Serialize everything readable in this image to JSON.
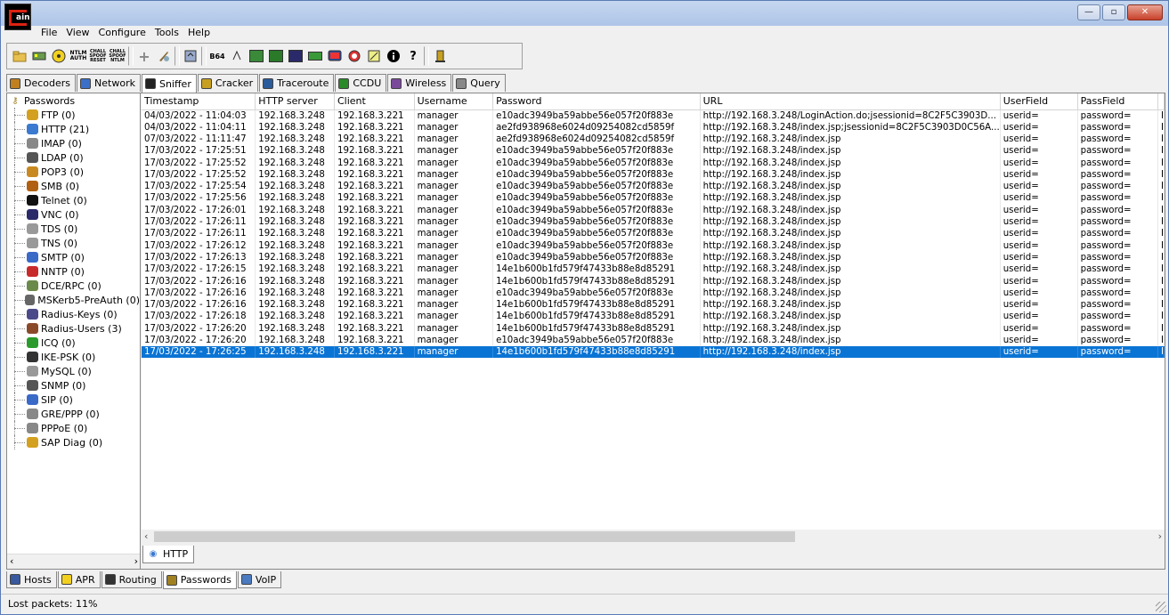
{
  "app": {
    "logo_text": "ain"
  },
  "menu": [
    "File",
    "View",
    "Configure",
    "Tools",
    "Help"
  ],
  "window_controls": {
    "minimize": "—",
    "maximize": "▫",
    "close": "✕"
  },
  "toolbar": {
    "icons": [
      "open-folder-icon",
      "network-card-icon",
      "radiation-icon",
      "ntlm-auth-icon",
      "chall-spoof-reset-icon",
      "chall-spoof-ntlm-icon",
      "add-icon",
      "broom-icon",
      "recycle-icon",
      "base64-icon",
      "terminal-icon",
      "lsa-icon",
      "lsa2-icon",
      "vnc-icon",
      "mem-icon",
      "monitor-icon",
      "globe-icon",
      "edit-icon",
      "info-icon",
      "help-icon",
      "exit-icon"
    ],
    "ntlm_label": "NTLM\nAUTH",
    "chall1_label": "CHALL\nSPOOF\nRESET",
    "chall2_label": "CHALL\nSPOOF\nNTLM",
    "b64_label": "B64"
  },
  "tabs": [
    {
      "label": "Decoders",
      "icon": "decoder-icon",
      "color": "#c08020",
      "active": false
    },
    {
      "label": "Network",
      "icon": "network-icon",
      "color": "#3b6fc8",
      "active": false
    },
    {
      "label": "Sniffer",
      "icon": "sniffer-icon",
      "color": "#222222",
      "active": true
    },
    {
      "label": "Cracker",
      "icon": "cracker-icon",
      "color": "#c8a020",
      "active": false
    },
    {
      "label": "Traceroute",
      "icon": "traceroute-icon",
      "color": "#2a5a9a",
      "active": false
    },
    {
      "label": "CCDU",
      "icon": "ccdu-icon",
      "color": "#2a8a2a",
      "active": false
    },
    {
      "label": "Wireless",
      "icon": "wireless-icon",
      "color": "#7a4a9a",
      "active": false
    },
    {
      "label": "Query",
      "icon": "query-icon",
      "color": "#888888",
      "active": false
    }
  ],
  "tree": {
    "root": "Passwords",
    "items": [
      {
        "label": "FTP (0)",
        "icon": "ftp-icon",
        "color": "#d4a020"
      },
      {
        "label": "HTTP (21)",
        "icon": "http-icon",
        "color": "#3a7ad0"
      },
      {
        "label": "IMAP (0)",
        "icon": "imap-icon",
        "color": "#888888"
      },
      {
        "label": "LDAP (0)",
        "icon": "ldap-icon",
        "color": "#555555"
      },
      {
        "label": "POP3 (0)",
        "icon": "pop3-icon",
        "color": "#c88a20"
      },
      {
        "label": "SMB (0)",
        "icon": "smb-icon",
        "color": "#b06010"
      },
      {
        "label": "Telnet (0)",
        "icon": "telnet-icon",
        "color": "#111111"
      },
      {
        "label": "VNC (0)",
        "icon": "vnc-icon",
        "color": "#2a2a6a"
      },
      {
        "label": "TDS (0)",
        "icon": "tds-icon",
        "color": "#999999"
      },
      {
        "label": "TNS (0)",
        "icon": "tns-icon",
        "color": "#999999"
      },
      {
        "label": "SMTP (0)",
        "icon": "smtp-icon",
        "color": "#3a6ac8"
      },
      {
        "label": "NNTP (0)",
        "icon": "nntp-icon",
        "color": "#c82a2a"
      },
      {
        "label": "DCE/RPC (0)",
        "icon": "dcerpc-icon",
        "color": "#6a8a4a"
      },
      {
        "label": "MSKerb5-PreAuth (0)",
        "icon": "mskerb5-icon",
        "color": "#666666"
      },
      {
        "label": "Radius-Keys (0)",
        "icon": "radius-keys-icon",
        "color": "#4a4a8a"
      },
      {
        "label": "Radius-Users (3)",
        "icon": "radius-users-icon",
        "color": "#8a4a2a"
      },
      {
        "label": "ICQ (0)",
        "icon": "icq-icon",
        "color": "#2a9a2a"
      },
      {
        "label": "IKE-PSK (0)",
        "icon": "ike-psk-icon",
        "color": "#333333"
      },
      {
        "label": "MySQL (0)",
        "icon": "mysql-icon",
        "color": "#999999"
      },
      {
        "label": "SNMP (0)",
        "icon": "snmp-icon",
        "color": "#555555"
      },
      {
        "label": "SIP (0)",
        "icon": "sip-icon",
        "color": "#3a6ac8"
      },
      {
        "label": "GRE/PPP (0)",
        "icon": "gre-ppp-icon",
        "color": "#888888"
      },
      {
        "label": "PPPoE (0)",
        "icon": "pppoe-icon",
        "color": "#888888"
      },
      {
        "label": "SAP Diag (0)",
        "icon": "sap-diag-icon",
        "color": "#d4a020"
      }
    ]
  },
  "grid": {
    "columns": [
      "Timestamp",
      "HTTP server",
      "Client",
      "Username",
      "Password",
      "URL",
      "UserField",
      "PassField",
      ""
    ],
    "rows": [
      [
        "04/03/2022 - 11:04:03",
        "192.168.3.248",
        "192.168.3.221",
        "manager",
        "e10adc3949ba59abbe56e057f20f883e",
        "http://192.168.3.248/LoginAction.do;jsessionid=8C2F5C3903D...",
        "userid=",
        "password=",
        "I"
      ],
      [
        "04/03/2022 - 11:04:11",
        "192.168.3.248",
        "192.168.3.221",
        "manager",
        "ae2fd938968e6024d09254082cd5859f",
        "http://192.168.3.248/index.jsp;jsessionid=8C2F5C3903D0C56A...",
        "userid=",
        "password=",
        "I"
      ],
      [
        "07/03/2022 - 11:11:47",
        "192.168.3.248",
        "192.168.3.221",
        "manager",
        "ae2fd938968e6024d09254082cd5859f",
        "http://192.168.3.248/index.jsp",
        "userid=",
        "password=",
        "I"
      ],
      [
        "17/03/2022 - 17:25:51",
        "192.168.3.248",
        "192.168.3.221",
        "manager",
        "e10adc3949ba59abbe56e057f20f883e",
        "http://192.168.3.248/index.jsp",
        "userid=",
        "password=",
        "I"
      ],
      [
        "17/03/2022 - 17:25:52",
        "192.168.3.248",
        "192.168.3.221",
        "manager",
        "e10adc3949ba59abbe56e057f20f883e",
        "http://192.168.3.248/index.jsp",
        "userid=",
        "password=",
        "I"
      ],
      [
        "17/03/2022 - 17:25:52",
        "192.168.3.248",
        "192.168.3.221",
        "manager",
        "e10adc3949ba59abbe56e057f20f883e",
        "http://192.168.3.248/index.jsp",
        "userid=",
        "password=",
        "I"
      ],
      [
        "17/03/2022 - 17:25:54",
        "192.168.3.248",
        "192.168.3.221",
        "manager",
        "e10adc3949ba59abbe56e057f20f883e",
        "http://192.168.3.248/index.jsp",
        "userid=",
        "password=",
        "I"
      ],
      [
        "17/03/2022 - 17:25:56",
        "192.168.3.248",
        "192.168.3.221",
        "manager",
        "e10adc3949ba59abbe56e057f20f883e",
        "http://192.168.3.248/index.jsp",
        "userid=",
        "password=",
        "I"
      ],
      [
        "17/03/2022 - 17:26:01",
        "192.168.3.248",
        "192.168.3.221",
        "manager",
        "e10adc3949ba59abbe56e057f20f883e",
        "http://192.168.3.248/index.jsp",
        "userid=",
        "password=",
        "I"
      ],
      [
        "17/03/2022 - 17:26:11",
        "192.168.3.248",
        "192.168.3.221",
        "manager",
        "e10adc3949ba59abbe56e057f20f883e",
        "http://192.168.3.248/index.jsp",
        "userid=",
        "password=",
        "I"
      ],
      [
        "17/03/2022 - 17:26:11",
        "192.168.3.248",
        "192.168.3.221",
        "manager",
        "e10adc3949ba59abbe56e057f20f883e",
        "http://192.168.3.248/index.jsp",
        "userid=",
        "password=",
        "I"
      ],
      [
        "17/03/2022 - 17:26:12",
        "192.168.3.248",
        "192.168.3.221",
        "manager",
        "e10adc3949ba59abbe56e057f20f883e",
        "http://192.168.3.248/index.jsp",
        "userid=",
        "password=",
        "I"
      ],
      [
        "17/03/2022 - 17:26:13",
        "192.168.3.248",
        "192.168.3.221",
        "manager",
        "e10adc3949ba59abbe56e057f20f883e",
        "http://192.168.3.248/index.jsp",
        "userid=",
        "password=",
        "I"
      ],
      [
        "17/03/2022 - 17:26:15",
        "192.168.3.248",
        "192.168.3.221",
        "manager",
        "14e1b600b1fd579f47433b88e8d85291",
        "http://192.168.3.248/index.jsp",
        "userid=",
        "password=",
        "I"
      ],
      [
        "17/03/2022 - 17:26:16",
        "192.168.3.248",
        "192.168.3.221",
        "manager",
        "14e1b600b1fd579f47433b88e8d85291",
        "http://192.168.3.248/index.jsp",
        "userid=",
        "password=",
        "I"
      ],
      [
        "17/03/2022 - 17:26:16",
        "192.168.3.248",
        "192.168.3.221",
        "manager",
        "e10adc3949ba59abbe56e057f20f883e",
        "http://192.168.3.248/index.jsp",
        "userid=",
        "password=",
        "I"
      ],
      [
        "17/03/2022 - 17:26:16",
        "192.168.3.248",
        "192.168.3.221",
        "manager",
        "14e1b600b1fd579f47433b88e8d85291",
        "http://192.168.3.248/index.jsp",
        "userid=",
        "password=",
        "I"
      ],
      [
        "17/03/2022 - 17:26:18",
        "192.168.3.248",
        "192.168.3.221",
        "manager",
        "14e1b600b1fd579f47433b88e8d85291",
        "http://192.168.3.248/index.jsp",
        "userid=",
        "password=",
        "I"
      ],
      [
        "17/03/2022 - 17:26:20",
        "192.168.3.248",
        "192.168.3.221",
        "manager",
        "14e1b600b1fd579f47433b88e8d85291",
        "http://192.168.3.248/index.jsp",
        "userid=",
        "password=",
        "I"
      ],
      [
        "17/03/2022 - 17:26:20",
        "192.168.3.248",
        "192.168.3.221",
        "manager",
        "e10adc3949ba59abbe56e057f20f883e",
        "http://192.168.3.248/index.jsp",
        "userid=",
        "password=",
        "I"
      ],
      [
        "17/03/2022 - 17:26:25",
        "192.168.3.248",
        "192.168.3.221",
        "manager",
        "14e1b600b1fd579f47433b88e8d85291",
        "http://192.168.3.248/index.jsp",
        "userid=",
        "password=",
        "I"
      ]
    ],
    "selected_row": 20,
    "selection_color": "#0a74d4"
  },
  "subtab": {
    "label": "HTTP",
    "icon": "http-icon"
  },
  "bottom_tabs": [
    {
      "label": "Hosts",
      "icon": "hosts-icon",
      "active": false
    },
    {
      "label": "APR",
      "icon": "apr-icon",
      "active": false
    },
    {
      "label": "Routing",
      "icon": "routing-icon",
      "active": false
    },
    {
      "label": "Passwords",
      "icon": "passwords-icon",
      "active": true
    },
    {
      "label": "VoIP",
      "icon": "voip-icon",
      "active": false
    }
  ],
  "status": {
    "text": "Lost packets:  11%"
  }
}
